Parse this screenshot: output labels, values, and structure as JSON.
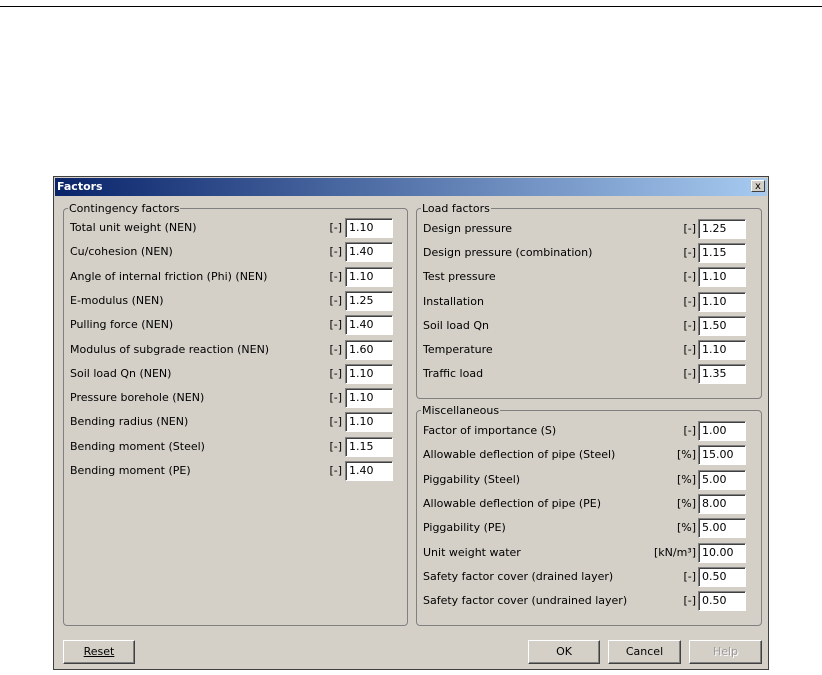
{
  "window": {
    "title": "Factors",
    "close_label": "x"
  },
  "contingency": {
    "title": "Contingency factors",
    "rows": [
      {
        "label": "Total unit weight (NEN)",
        "unit": "[-]",
        "value": "1.10"
      },
      {
        "label": "Cu/cohesion (NEN)",
        "unit": "[-]",
        "value": "1.40"
      },
      {
        "label": "Angle of internal friction (Phi) (NEN)",
        "unit": "[-]",
        "value": "1.10"
      },
      {
        "label": "E-modulus (NEN)",
        "unit": "[-]",
        "value": "1.25"
      },
      {
        "label": "Pulling force (NEN)",
        "unit": "[-]",
        "value": "1.40"
      },
      {
        "label": "Modulus of subgrade reaction (NEN)",
        "unit": "[-]",
        "value": "1.60"
      },
      {
        "label": "Soil load Qn (NEN)",
        "unit": "[-]",
        "value": "1.10"
      },
      {
        "label": "Pressure borehole (NEN)",
        "unit": "[-]",
        "value": "1.10"
      },
      {
        "label": "Bending radius (NEN)",
        "unit": "[-]",
        "value": "1.10"
      },
      {
        "label": "Bending moment (Steel)",
        "unit": "[-]",
        "value": "1.15"
      },
      {
        "label": "Bending moment (PE)",
        "unit": "[-]",
        "value": "1.40"
      }
    ]
  },
  "load": {
    "title": "Load factors",
    "rows": [
      {
        "label": "Design pressure",
        "unit": "[-]",
        "value": "1.25"
      },
      {
        "label": "Design pressure (combination)",
        "unit": "[-]",
        "value": "1.15"
      },
      {
        "label": "Test pressure",
        "unit": "[-]",
        "value": "1.10"
      },
      {
        "label": "Installation",
        "unit": "[-]",
        "value": "1.10"
      },
      {
        "label": "Soil load Qn",
        "unit": "[-]",
        "value": "1.50"
      },
      {
        "label": "Temperature",
        "unit": "[-]",
        "value": "1.10"
      },
      {
        "label": "Traffic load",
        "unit": "[-]",
        "value": "1.35"
      }
    ]
  },
  "misc": {
    "title": "Miscellaneous",
    "rows": [
      {
        "label": "Factor of importance  (S)",
        "unit": "[-]",
        "value": "1.00"
      },
      {
        "label": "Allowable deflection of pipe (Steel)",
        "unit": "[%]",
        "value": "15.00"
      },
      {
        "label": "Piggability (Steel)",
        "unit": "[%]",
        "value": "5.00"
      },
      {
        "label": "Allowable deflection of pipe (PE)",
        "unit": "[%]",
        "value": "8.00"
      },
      {
        "label": "Piggability (PE)",
        "unit": "[%]",
        "value": "5.00"
      },
      {
        "label": "Unit weight water",
        "unit": "[kN/m³]",
        "value": "10.00"
      },
      {
        "label": "Safety factor cover (drained layer)",
        "unit": "[-]",
        "value": "0.50"
      },
      {
        "label": "Safety factor cover (undrained layer)",
        "unit": "[-]",
        "value": "0.50"
      }
    ]
  },
  "buttons": {
    "reset": "Reset",
    "ok": "OK",
    "cancel": "Cancel",
    "help": "Help"
  }
}
